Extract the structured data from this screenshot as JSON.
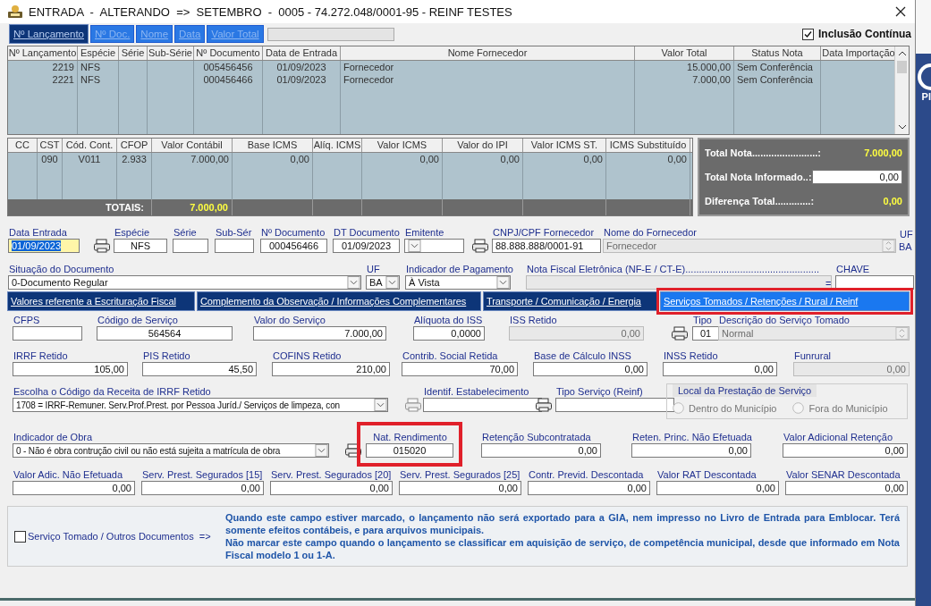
{
  "window": {
    "title": "ENTRADA  -  ALTERANDO  =>  SETEMBRO  -  0005 - 74.272.048/0001-95 - REINF TESTES"
  },
  "background": {
    "fragment": "Pl"
  },
  "search_tabs": [
    {
      "label": "Nº Lançamento",
      "selected": true
    },
    {
      "label": "Nº Doc.",
      "selected": false
    },
    {
      "label": "Nome",
      "selected": false
    },
    {
      "label": "Data",
      "selected": false
    },
    {
      "label": "Valor Total",
      "selected": false
    }
  ],
  "continuous_insert": {
    "label": "Inclusão Contínua",
    "checked": true
  },
  "entries_table": {
    "columns": [
      "Nº Lançamento",
      "Espécie",
      "Série",
      "Sub-Série",
      "Nº Documento",
      "Data de Entrada",
      "Nome Fornecedor",
      "Valor Total",
      "Status Nota",
      "Data Importação"
    ],
    "rows": [
      [
        "2219",
        "NFS",
        "",
        "",
        "005456456",
        "01/09/2023",
        "Fornecedor",
        "15.000,00",
        "Sem Conferência",
        ""
      ],
      [
        "2221",
        "NFS",
        "",
        "",
        "000456466",
        "01/09/2023",
        "Fornecedor",
        "7.000,00",
        "Sem Conferência",
        ""
      ]
    ]
  },
  "items_table": {
    "columns": [
      "CC",
      "CST",
      "Cód. Cont.",
      "CFOP",
      "Valor Contábil",
      "Base ICMS",
      "Alíq. ICMS",
      "Valor ICMS",
      "Valor do IPI",
      "Valor ICMS ST.",
      "ICMS Substituído"
    ],
    "rows": [
      [
        "",
        "090",
        "V011",
        "2.933",
        "7.000,00",
        "0,00",
        "",
        "0,00",
        "0,00",
        "0,00",
        "0,00"
      ]
    ],
    "totals_label": "TOTAIS:",
    "totals_value": "7.000,00"
  },
  "totals": [
    {
      "label": "Total Nota........................:",
      "value": "7.000,00",
      "kind": "value"
    },
    {
      "label": "Total Nota Informado..:",
      "value": "0,00",
      "kind": "input"
    },
    {
      "label": "Diferença Total.............:",
      "value": "0,00",
      "kind": "value"
    }
  ],
  "header_rows": [
    [
      {
        "kind": "date",
        "label": "Data Entrada",
        "value": "01/09/2023"
      },
      {
        "kind": "lookup"
      },
      {
        "kind": "text",
        "label": "Espécie",
        "value": "NFS"
      },
      {
        "kind": "text",
        "label": "Série"
      },
      {
        "kind": "text",
        "label": "Sub-Sér"
      },
      {
        "kind": "text",
        "label": "Nº Documento",
        "value": "000456466"
      },
      {
        "kind": "text",
        "label": "DT Documento",
        "value": "01/09/2023"
      },
      {
        "kind": "select",
        "label": "Emitente"
      },
      {
        "kind": "lookup"
      },
      {
        "kind": "text",
        "label": "CNPJ/CPF Fornecedor",
        "value": "88.888.888/0001-91"
      },
      {
        "kind": "spin",
        "label": "Nome do Fornecedor",
        "value": "Fornecedor",
        "disabled": true
      },
      {
        "kind": "plain",
        "label": "UF",
        "value": "BA"
      }
    ],
    [
      {
        "kind": "select",
        "label": "Situação do Documento",
        "value": "0-Documento Regular"
      },
      {
        "kind": "select",
        "label": "UF",
        "value": "BA"
      },
      {
        "kind": "select",
        "label": "Indicador de Pagamento",
        "value": "À Vista"
      },
      {
        "kind": "text",
        "label": "Nota Fiscal Eletrônica (NF-E / CT-E).................................................",
        "disabled": true
      },
      {
        "kind": "plain",
        "label": "="
      },
      {
        "kind": "text",
        "label": "CHAVE"
      }
    ]
  ],
  "section_tabs": [
    {
      "label": "Valores referente a Escrituração Fiscal",
      "selected": false,
      "highlighted": false
    },
    {
      "label": "Complemento da Observação / Informações Complementares",
      "selected": false,
      "highlighted": false
    },
    {
      "label": "Transporte / Comunicação / Energia",
      "selected": false,
      "highlighted": false
    },
    {
      "label": "Serviços Tomados / Retenções / Rural / Reinf",
      "selected": true,
      "highlighted": true
    }
  ],
  "form_rows": [
    [
      {
        "kind": "text",
        "label": "CFPS"
      },
      {
        "kind": "text",
        "label": "Código de Serviço",
        "value": "564564"
      },
      {
        "kind": "text",
        "label": "Valor do Serviço",
        "value": "7.000,00"
      },
      {
        "kind": "text",
        "label": "Alíquota do ISS",
        "value": "0,0000"
      },
      {
        "kind": "text",
        "label": "ISS Retido",
        "value": "0,00",
        "disabled": true
      },
      {
        "kind": "lookup"
      },
      {
        "kind": "text",
        "label": "Tipo",
        "value": "01"
      },
      {
        "kind": "spin",
        "label": "Descrição do Serviço Tomado",
        "value": "Normal",
        "disabled": true
      }
    ],
    [
      {
        "kind": "text",
        "label": "IRRF Retido",
        "value": "105,00"
      },
      {
        "kind": "text",
        "label": "PIS Retido",
        "value": "45,50"
      },
      {
        "kind": "text",
        "label": "COFINS Retido",
        "value": "210,00"
      },
      {
        "kind": "text",
        "label": "Contrib. Social Retida",
        "value": "70,00"
      },
      {
        "kind": "text",
        "label": "Base de Cálculo INSS",
        "value": "0,00"
      },
      {
        "kind": "text",
        "label": "INSS Retido",
        "value": "0,00"
      },
      {
        "kind": "text",
        "label": "Funrural",
        "value": "0,00",
        "disabled": true
      }
    ],
    [
      {
        "kind": "select",
        "label": "Escolha o Código da Receita de IRRF Retido",
        "value": "1708 = IRRF-Remuner. Serv.Prof.Prest. por Pessoa Juríd./ Serviços de limpeza, con"
      },
      {
        "kind": "lookup",
        "disabled": true
      },
      {
        "kind": "text",
        "label": "Identif. Estabelecimento"
      },
      {
        "kind": "lookup"
      },
      {
        "kind": "text",
        "label": "Tipo Serviço (Reinf)"
      },
      {
        "kind": "group",
        "label": "Local da Prestação de Serviço",
        "options": [
          {
            "label": "Dentro do Município",
            "selected": false
          },
          {
            "label": "Fora do Município",
            "selected": false
          }
        ]
      }
    ],
    [
      {
        "kind": "select",
        "label": "Indicador de Obra",
        "value": "0 - Não é obra contrução civil ou não está sujeita a matrícula de obra"
      },
      {
        "kind": "lookup"
      },
      {
        "kind": "text",
        "label": "Nat. Rendimento",
        "value": "015020",
        "highlighted": true
      },
      {
        "kind": "text",
        "label": "Retenção Subcontratada",
        "value": "0,00"
      },
      {
        "kind": "text",
        "label": "Reten. Princ. Não Efetuada",
        "value": "0,00"
      },
      {
        "kind": "text",
        "label": "Valor Adicional Retenção",
        "value": "0,00"
      }
    ],
    [
      {
        "kind": "text",
        "label": "Valor Adic. Não Efetuada",
        "value": "0,00"
      },
      {
        "kind": "text",
        "label": "Serv. Prest. Segurados [15]",
        "value": "0,00"
      },
      {
        "kind": "text",
        "label": "Serv. Prest. Segurados [20]",
        "value": "0,00"
      },
      {
        "kind": "text",
        "label": "Serv. Prest. Segurados [25]",
        "value": "0,00"
      },
      {
        "kind": "text",
        "label": "Contr. Previd. Descontada",
        "value": "0,00"
      },
      {
        "kind": "text",
        "label": "Valor RAT Descontada",
        "value": "0,00"
      },
      {
        "kind": "text",
        "label": "Valor SENAR Descontada",
        "value": "0,00"
      }
    ]
  ],
  "other_documents": {
    "label": "Serviço Tomado / Outros Documentos  =>",
    "checked": false,
    "notes": [
      "Quando este campo estiver marcado, o lançamento não será exportado para a GIA, nem impresso no Livro de Entrada para Emblocar. Terá somente efeitos contábeis, e para arquivos municipais.",
      "Não marcar este campo quando o lançamento se classificar em aquisição de serviço, de competência municipal, desde que informado em Nota Fiscal modelo 1 ou 1-A."
    ]
  }
}
